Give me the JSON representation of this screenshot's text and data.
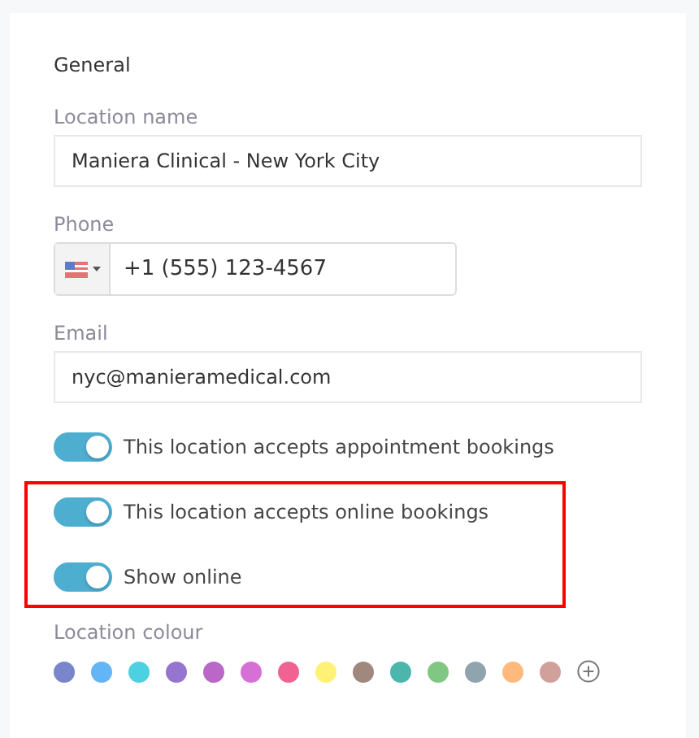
{
  "section_title": "General",
  "fields": [
    {
      "kind": "text",
      "label": "Location name",
      "value": "Maniera Clinical - New York City"
    },
    {
      "kind": "phone",
      "label": "Phone",
      "value": "+1 (555) 123-4567"
    },
    {
      "kind": "text",
      "label": "Email",
      "value": "nyc@manieramedical.com"
    }
  ],
  "toggle_groups": [
    {
      "highlighted": false,
      "items": [
        {
          "label": "This location accepts appointment bookings",
          "on": true
        }
      ]
    },
    {
      "highlighted": true,
      "items": [
        {
          "label": "This location accepts online bookings",
          "on": true
        },
        {
          "label": "Show online",
          "on": true
        }
      ]
    }
  ],
  "colour_picker": {
    "label": "Location colour",
    "colours": [
      {
        "color": "#7986cb"
      },
      {
        "color": "#64b5f6"
      },
      {
        "color": "#4dd0e1"
      },
      {
        "color": "#9575cd"
      },
      {
        "color": "#ba68c8"
      },
      {
        "color": "#d66fd6"
      },
      {
        "color": "#f06292"
      },
      {
        "color": "#fff176"
      },
      {
        "color": "#a1887f"
      },
      {
        "color": "#4db6ac"
      },
      {
        "color": "#81c784"
      },
      {
        "color": "#90a4ae"
      },
      {
        "color": "#ffb97d"
      },
      {
        "color": "#d1a09b"
      }
    ]
  }
}
